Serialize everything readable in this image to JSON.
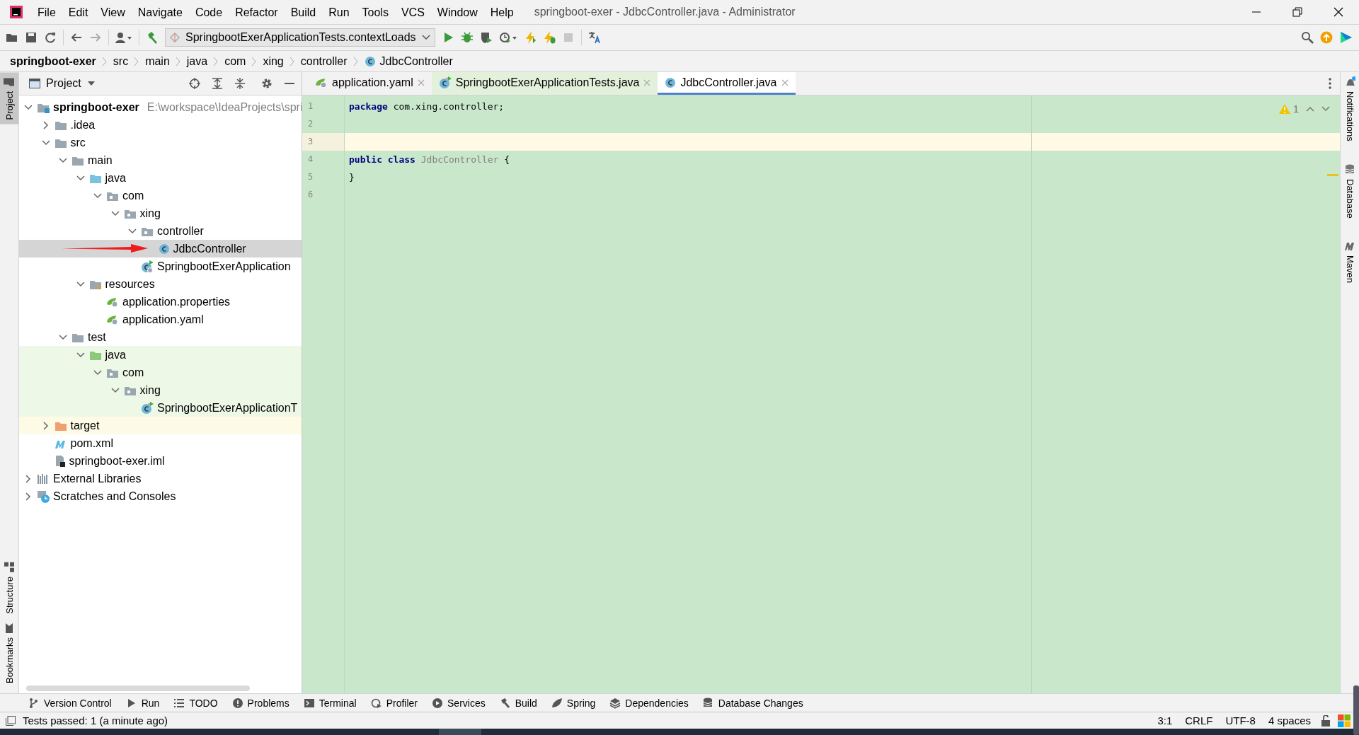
{
  "window": {
    "title": "springboot-exer - JdbcController.java - Administrator"
  },
  "menu": [
    "File",
    "Edit",
    "View",
    "Navigate",
    "Code",
    "Refactor",
    "Build",
    "Run",
    "Tools",
    "VCS",
    "Window",
    "Help"
  ],
  "toolbar": {
    "run_configuration": "SpringbootExerApplicationTests.contextLoads"
  },
  "breadcrumbs": [
    {
      "label": "springboot-exer",
      "kind": "root"
    },
    {
      "label": "src",
      "kind": "plain"
    },
    {
      "label": "main",
      "kind": "plain"
    },
    {
      "label": "java",
      "kind": "plain"
    },
    {
      "label": "com",
      "kind": "plain"
    },
    {
      "label": "xing",
      "kind": "plain"
    },
    {
      "label": "controller",
      "kind": "plain"
    },
    {
      "label": "JdbcController",
      "kind": "class"
    }
  ],
  "left_stripe": [
    {
      "label": "Project",
      "selected": true
    },
    {
      "label": "Structure",
      "selected": false
    },
    {
      "label": "Bookmarks",
      "selected": false
    }
  ],
  "right_stripe": [
    {
      "label": "Notifications",
      "selected": false
    },
    {
      "label": "Database",
      "selected": false
    },
    {
      "label": "Maven",
      "selected": false
    }
  ],
  "project": {
    "title": "Project",
    "tree": [
      {
        "label": "springboot-exer",
        "path": "E:\\workspace\\IdeaProjects\\spri",
        "kind": "module",
        "expanded": true,
        "selected": false,
        "children": [
          {
            "label": ".idea",
            "kind": "folder",
            "expanded": false,
            "selected": false
          },
          {
            "label": "src",
            "kind": "folder",
            "expanded": true,
            "selected": false,
            "children": [
              {
                "label": "main",
                "kind": "folder",
                "expanded": true,
                "selected": false,
                "children": [
                  {
                    "label": "java",
                    "kind": "source",
                    "expanded": true,
                    "selected": false,
                    "children": [
                      {
                        "label": "com",
                        "kind": "package",
                        "expanded": true,
                        "selected": false,
                        "children": [
                          {
                            "label": "xing",
                            "kind": "package",
                            "expanded": true,
                            "selected": false,
                            "children": [
                              {
                                "label": "controller",
                                "kind": "package",
                                "expanded": true,
                                "selected": false,
                                "children": [
                                  {
                                    "label": "JdbcController",
                                    "kind": "class",
                                    "selected": true
                                  }
                                ]
                              },
                              {
                                "label": "SpringbootExerApplication",
                                "kind": "boot",
                                "selected": false
                              }
                            ]
                          }
                        ]
                      }
                    ]
                  },
                  {
                    "label": "resources",
                    "kind": "resources",
                    "expanded": true,
                    "selected": false,
                    "children": [
                      {
                        "label": "application.properties",
                        "kind": "config",
                        "selected": false
                      },
                      {
                        "label": "application.yaml",
                        "kind": "config",
                        "selected": false
                      }
                    ]
                  }
                ]
              },
              {
                "label": "test",
                "kind": "folder",
                "expanded": true,
                "selected": false,
                "children": [
                  {
                    "label": "java",
                    "kind": "testsource",
                    "test_scope": true,
                    "expanded": true,
                    "selected": false,
                    "children": [
                      {
                        "label": "com",
                        "kind": "package",
                        "test_scope": true,
                        "expanded": true,
                        "selected": false,
                        "children": [
                          {
                            "label": "xing",
                            "kind": "package",
                            "test_scope": true,
                            "expanded": true,
                            "selected": false,
                            "children": [
                              {
                                "label": "SpringbootExerApplicationT",
                                "kind": "testclass",
                                "test_scope": true,
                                "selected": false
                              }
                            ]
                          }
                        ]
                      }
                    ]
                  }
                ]
              }
            ]
          },
          {
            "label": "target",
            "kind": "excluded",
            "excluded": true,
            "expanded": false,
            "selected": false
          },
          {
            "label": "pom.xml",
            "kind": "maven",
            "selected": false
          },
          {
            "label": "springboot-exer.iml",
            "kind": "iml",
            "selected": false
          }
        ]
      },
      {
        "label": "External Libraries",
        "kind": "libraries",
        "expanded": false,
        "selected": false
      },
      {
        "label": "Scratches and Consoles",
        "kind": "scratches",
        "expanded": false,
        "selected": false
      }
    ]
  },
  "editor_tabs": [
    {
      "label": "application.yaml",
      "kind": "config",
      "selected": false
    },
    {
      "label": "SpringbootExerApplicationTests.java",
      "kind": "testclass",
      "test_scope": true,
      "selected": false
    },
    {
      "label": "JdbcController.java",
      "kind": "class",
      "selected": true
    }
  ],
  "editor": {
    "warnings": "1",
    "lines": [
      {
        "number": "1",
        "current": false,
        "tokens": [
          {
            "kind": "keyword",
            "text": "package"
          },
          {
            "kind": "plain",
            "text": "com.xing.controller;"
          }
        ]
      },
      {
        "number": "2",
        "current": false
      },
      {
        "number": "3",
        "current": true
      },
      {
        "number": "4",
        "current": false,
        "tokens": [
          {
            "kind": "keyword",
            "text": "public class"
          },
          {
            "kind": "unused",
            "text": "JdbcController"
          },
          {
            "kind": "plain",
            "text": "{"
          }
        ]
      },
      {
        "number": "5",
        "current": false,
        "tokens": [
          {
            "kind": "plain",
            "text": "}"
          }
        ]
      },
      {
        "number": "6",
        "current": false
      }
    ]
  },
  "tool_windows": [
    "Version Control",
    "Run",
    "TODO",
    "Problems",
    "Terminal",
    "Profiler",
    "Services",
    "Build",
    "Spring",
    "Dependencies",
    "Database Changes"
  ],
  "status_bar": {
    "message": "Tests passed: 1 (a minute ago)",
    "items": [
      "3:1",
      "CRLF",
      "UTF-8",
      "4 spaces"
    ]
  }
}
